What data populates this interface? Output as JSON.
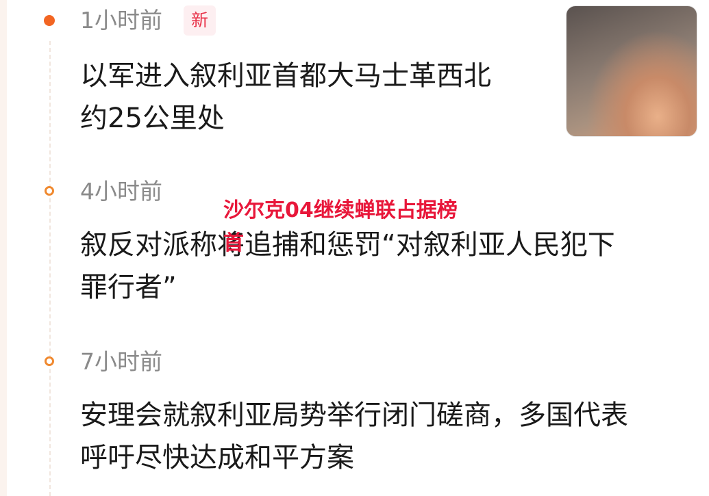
{
  "items": [
    {
      "time": "1小时前",
      "badge": "新",
      "headline_line1": "以军进入叙利亚首都大马士革西北",
      "headline_line2": "约25公里处"
    },
    {
      "time": "4小时前",
      "headline_line1": "叙反对派称将追捕和惩罚“对叙利亚人民犯下",
      "headline_line2": "罪行者”"
    },
    {
      "time": "7小时前",
      "headline_line1": "安理会就叙利亚局势举行闭门磋商，多国代表",
      "headline_line2": "呼吁尽快达成和平方案"
    }
  ],
  "overlay": {
    "line1": "沙尔克04继续蝉联占据榜",
    "line2": "首"
  },
  "colors": {
    "accent": "#f26522",
    "badge_text": "#e8334a",
    "overlay_text": "#e8173a"
  }
}
